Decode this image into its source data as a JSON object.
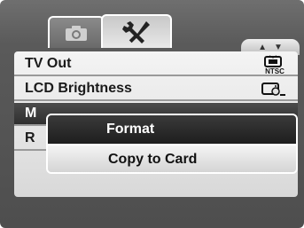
{
  "tabs": [
    {
      "name": "camera",
      "icon": "camera-icon",
      "active": false
    },
    {
      "name": "setup",
      "icon": "wrench-screwdriver-icon",
      "active": true
    }
  ],
  "scroll_indicator": {
    "up": "▲",
    "down": "▼"
  },
  "menu": {
    "items": [
      {
        "label": "TV Out",
        "value_icon": "ntsc-tv-icon",
        "value_text": "NTSC"
      },
      {
        "label": "LCD Brightness",
        "value_icon": "lcd-brightness-icon"
      },
      {
        "label": "M",
        "selected": true
      },
      {
        "label": "R"
      }
    ]
  },
  "submenu": {
    "items": [
      {
        "label": "Format",
        "selected": true
      },
      {
        "label": "Copy to Card",
        "selected": false
      }
    ]
  }
}
